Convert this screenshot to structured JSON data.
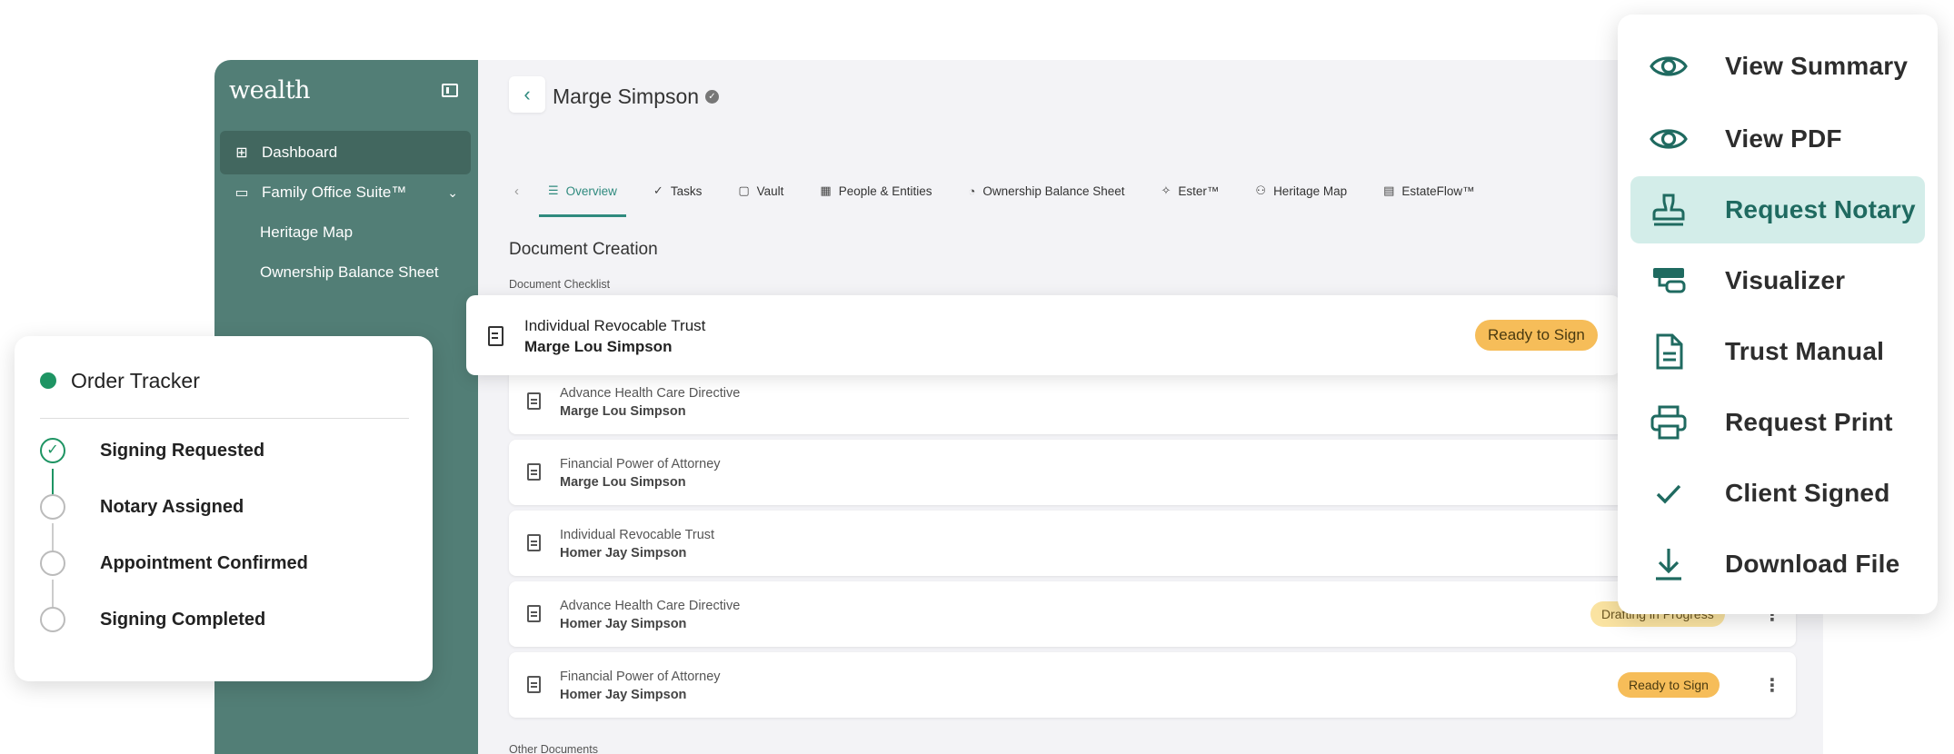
{
  "sidebar": {
    "logo": "wealth",
    "items": [
      {
        "label": "Dashboard",
        "icon": "grid-icon"
      },
      {
        "label": "Family Office Suite™",
        "icon": "briefcase-icon"
      },
      {
        "label": "Heritage Map"
      },
      {
        "label": "Ownership Balance Sheet"
      }
    ]
  },
  "header": {
    "client_name": "Marge Simpson"
  },
  "tabs": [
    {
      "label": "Overview",
      "icon": "list-icon"
    },
    {
      "label": "Tasks",
      "icon": "check-list-icon"
    },
    {
      "label": "Vault",
      "icon": "folder-icon"
    },
    {
      "label": "People & Entities",
      "icon": "building-icon"
    },
    {
      "label": "Ownership Balance Sheet",
      "icon": "pie-icon"
    },
    {
      "label": "Ester™",
      "icon": "sparkle-icon"
    },
    {
      "label": "Heritage Map",
      "icon": "people-icon"
    },
    {
      "label": "EstateFlow™",
      "icon": "flow-icon"
    }
  ],
  "main": {
    "section_title": "Document Creation",
    "checklist_label": "Document Checklist",
    "other_label": "Other Documents"
  },
  "highlight_doc": {
    "type": "Individual Revocable Trust",
    "person": "Marge Lou Simpson",
    "status": "Ready to Sign"
  },
  "documents": [
    {
      "type": "Advance Health Care Directive",
      "person": "Marge Lou Simpson",
      "status": ""
    },
    {
      "type": "Financial Power of Attorney",
      "person": "Marge Lou Simpson",
      "status": ""
    },
    {
      "type": "Individual Revocable Trust",
      "person": "Homer Jay Simpson",
      "status": ""
    },
    {
      "type": "Advance Health Care Directive",
      "person": "Homer Jay Simpson",
      "status": "Drafting in Progress"
    },
    {
      "type": "Financial Power of Attorney",
      "person": "Homer Jay Simpson",
      "status": "Ready to Sign"
    }
  ],
  "tracker": {
    "title": "Order Tracker",
    "steps": [
      {
        "label": "Signing Requested",
        "done": true
      },
      {
        "label": "Notary Assigned",
        "done": false
      },
      {
        "label": "Appointment Confirmed",
        "done": false
      },
      {
        "label": "Signing Completed",
        "done": false
      }
    ]
  },
  "menu": [
    {
      "label": "View Summary",
      "icon": "eye-icon"
    },
    {
      "label": "View PDF",
      "icon": "eye-icon"
    },
    {
      "label": "Request Notary",
      "icon": "stamp-icon",
      "active": true
    },
    {
      "label": "Visualizer",
      "icon": "visualizer-icon"
    },
    {
      "label": "Trust Manual",
      "icon": "document-icon"
    },
    {
      "label": "Request Print",
      "icon": "printer-icon"
    },
    {
      "label": "Client Signed",
      "icon": "check-icon"
    },
    {
      "label": "Download File",
      "icon": "download-icon"
    }
  ],
  "colors": {
    "accent": "#2f8a7e",
    "sidebar": "#527e76",
    "badge_ready": "#f6bd59",
    "badge_drafting": "#fae3a1",
    "success": "#1e9463"
  }
}
